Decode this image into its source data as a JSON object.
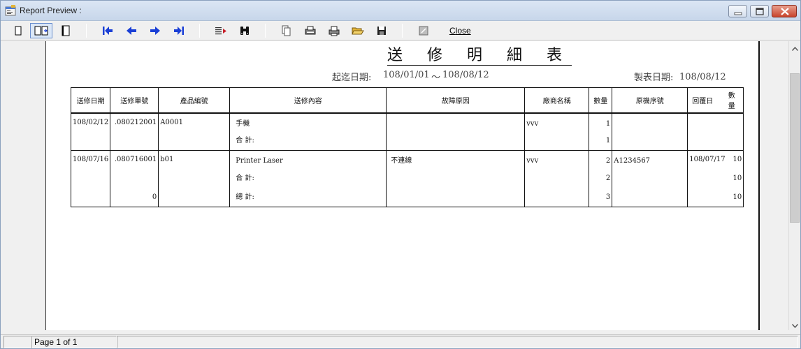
{
  "window": {
    "title": "Report Preview :"
  },
  "toolbar": {
    "buttons": [
      {
        "name": "one-page-button",
        "icon": "single-page-icon"
      },
      {
        "name": "two-page-button",
        "icon": "two-page-icon"
      },
      {
        "name": "whole-page-button",
        "icon": "whole-page-icon"
      },
      {
        "name": "first-page-button",
        "icon": "first-page-icon"
      },
      {
        "name": "prev-page-button",
        "icon": "prev-page-icon"
      },
      {
        "name": "next-page-button",
        "icon": "next-page-icon"
      },
      {
        "name": "last-page-button",
        "icon": "last-page-icon"
      },
      {
        "name": "goto-page-button",
        "icon": "goto-page-icon"
      },
      {
        "name": "find-button",
        "icon": "binoculars-icon"
      },
      {
        "name": "copy-button",
        "icon": "copy-icon"
      },
      {
        "name": "print-setup-button",
        "icon": "printer-setup-icon"
      },
      {
        "name": "print-button",
        "icon": "printer-icon"
      },
      {
        "name": "open-button",
        "icon": "folder-open-icon"
      },
      {
        "name": "save-button",
        "icon": "floppy-disk-icon"
      },
      {
        "name": "export-button",
        "icon": "export-icon"
      }
    ],
    "close_label": "Close"
  },
  "report": {
    "title": "送 修 明 細 表",
    "date_range_label": "起迄日期:",
    "date_from": "108/01/01",
    "date_sep": "～",
    "date_to": "108/08/12",
    "print_date_label": "製表日期:",
    "print_date": "108/08/12",
    "columns": [
      "送修日期",
      "送修單號",
      "產品編號",
      "送修內容",
      "故障原因",
      "廠商名稱",
      "數量",
      "原機序號",
      "回覆日",
      "數量"
    ],
    "groups": [
      {
        "date": "108/02/12",
        "order_no": ".080212001",
        "product": "A0001",
        "content": "手機",
        "reason": "",
        "vendor": "vvv",
        "qty": "1",
        "serial": "",
        "reply_date": "",
        "reply_qty": "",
        "subtotal_label": "合 計:",
        "subtotal_qty": "1",
        "subtotal_reply_qty": ""
      },
      {
        "date": "108/07/16",
        "order_no": ".080716001",
        "product": "b01",
        "content": "Printer Laser",
        "reason": "不連線",
        "vendor": "vvv",
        "qty": "2",
        "serial": "A1234567",
        "reply_date": "108/07/17",
        "reply_qty": "10",
        "subtotal_label": "合 計:",
        "subtotal_qty": "2",
        "subtotal_reply_qty": "10",
        "total_order_count": "0",
        "total_label": "總 計:",
        "total_qty": "3",
        "total_reply_qty": "10"
      }
    ]
  },
  "status": {
    "page_info": "Page 1 of 1"
  },
  "colors": {
    "arrow": "#1a3fd6",
    "title_bg": "#c7d6ea"
  }
}
